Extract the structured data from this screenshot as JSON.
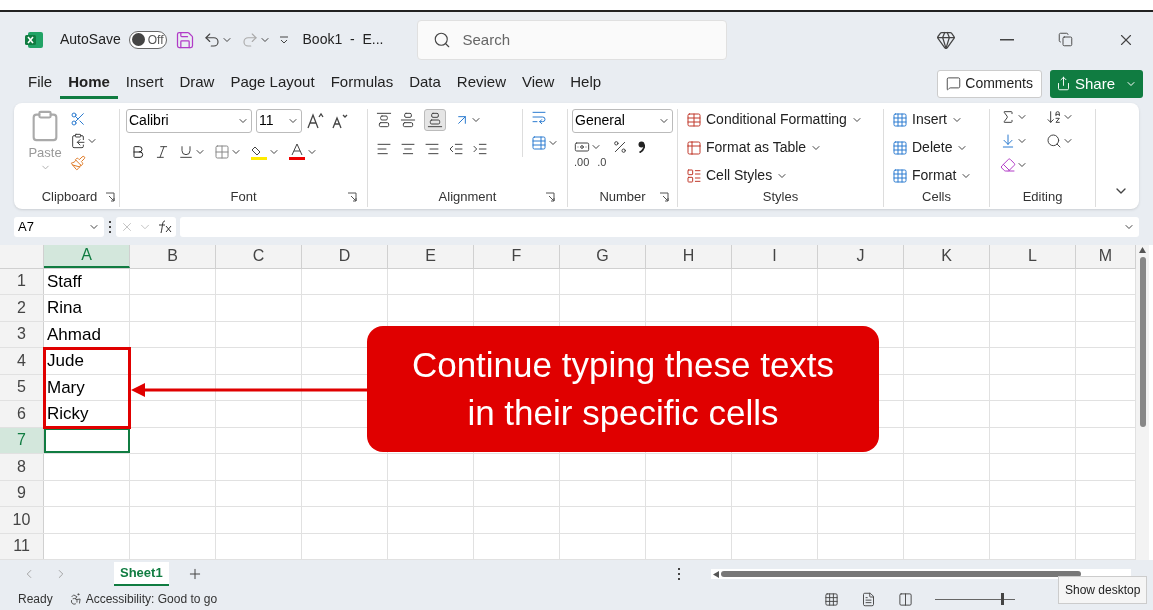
{
  "title_bar": {
    "autosave_label": "AutoSave",
    "autosave": {
      "label": "Off",
      "on": false
    },
    "document_title": "Book1  -  E...",
    "search": {
      "placeholder": "Search"
    }
  },
  "menu_tabs": [
    {
      "label": "File",
      "selected": false
    },
    {
      "label": "Home",
      "selected": true
    },
    {
      "label": "Insert",
      "selected": false
    },
    {
      "label": "Draw",
      "selected": false
    },
    {
      "label": "Page Layout",
      "selected": false
    },
    {
      "label": "Formulas",
      "selected": false
    },
    {
      "label": "Data",
      "selected": false
    },
    {
      "label": "Review",
      "selected": false
    },
    {
      "label": "View",
      "selected": false
    },
    {
      "label": "Help",
      "selected": false
    }
  ],
  "header_buttons": {
    "comments": "Comments",
    "share": "Share"
  },
  "ribbon": {
    "clipboard": {
      "paste": "Paste",
      "label": "Clipboard"
    },
    "font": {
      "font_name": "Calibri",
      "font_size": "11",
      "label": "Font"
    },
    "alignment": {
      "label": "Alignment"
    },
    "number": {
      "format": "General",
      "label": "Number",
      "decimals": [
        ".00",
        ".0"
      ]
    },
    "styles": {
      "buttons": [
        "Conditional Formatting",
        "Format as Table",
        "Cell Styles"
      ],
      "label": "Styles"
    },
    "cells": {
      "buttons": [
        "Insert",
        "Delete",
        "Format"
      ],
      "label": "Cells"
    },
    "editing": {
      "label": "Editing"
    }
  },
  "formula_bar": {
    "name_box": "A7"
  },
  "sheet": {
    "columns": [
      {
        "label": "A",
        "selected": true
      },
      {
        "label": "B",
        "selected": false
      },
      {
        "label": "C",
        "selected": false
      },
      {
        "label": "D",
        "selected": false
      },
      {
        "label": "E",
        "selected": false
      },
      {
        "label": "F",
        "selected": false
      },
      {
        "label": "G",
        "selected": false
      },
      {
        "label": "H",
        "selected": false
      },
      {
        "label": "I",
        "selected": false
      },
      {
        "label": "J",
        "selected": false
      },
      {
        "label": "K",
        "selected": false
      },
      {
        "label": "L",
        "selected": false
      },
      {
        "label": "M",
        "selected": false
      }
    ],
    "rows": [
      {
        "label": "1",
        "selected": false,
        "cell_a": "Staff"
      },
      {
        "label": "2",
        "selected": false,
        "cell_a": "Rina"
      },
      {
        "label": "3",
        "selected": false,
        "cell_a": "Ahmad"
      },
      {
        "label": "4",
        "selected": false,
        "cell_a": "Jude"
      },
      {
        "label": "5",
        "selected": false,
        "cell_a": "Mary"
      },
      {
        "label": "6",
        "selected": false,
        "cell_a": "Ricky"
      },
      {
        "label": "7",
        "selected": true
      },
      {
        "label": "8",
        "selected": false
      },
      {
        "label": "9",
        "selected": false
      },
      {
        "label": "10",
        "selected": false
      },
      {
        "label": "11",
        "selected": false
      }
    ]
  },
  "annotation": {
    "callout_lines": [
      "Continue typing these texts",
      "in their specific cells"
    ]
  },
  "sheet_tabs": [
    {
      "label": "Sheet1",
      "selected": true
    }
  ],
  "status_bar": {
    "zoom": {
      "level": 0.85
    },
    "status": "Ready",
    "accessibility": "Accessibility: Good to go",
    "tooltip": "Show desktop"
  }
}
